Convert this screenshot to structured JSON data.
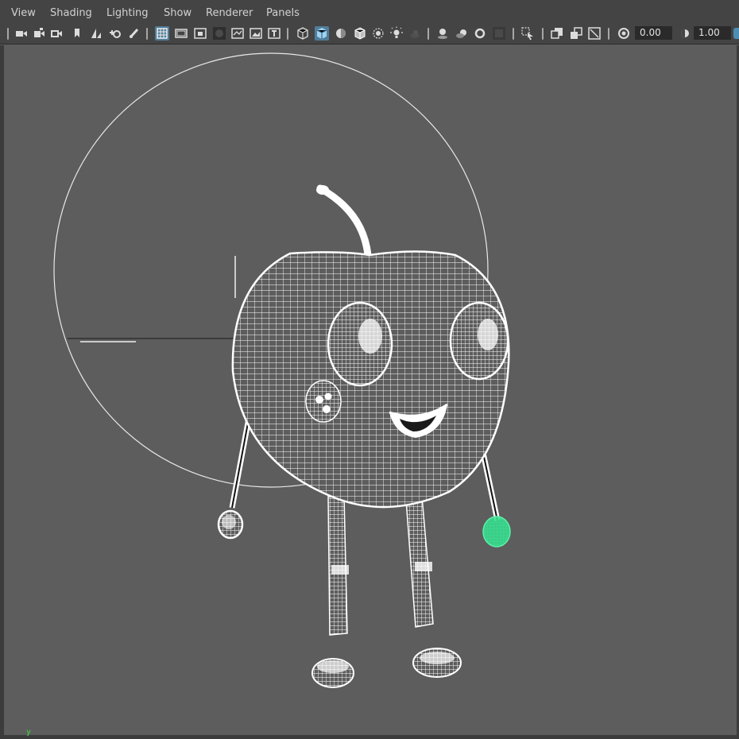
{
  "menu": {
    "items": [
      "View",
      "Shading",
      "Lighting",
      "Show",
      "Renderer",
      "Panels"
    ]
  },
  "toolbar": {
    "exposure_value": "0.00",
    "gamma_value": "1.00",
    "icons": [
      "camera-icon",
      "camera-attributes-icon",
      "camera-select-icon",
      "bookmark-icon",
      "image-plane-icon",
      "two-d-pan-zoom-icon",
      "grease-pencil-icon",
      "grid-icon",
      "film-gate-icon",
      "resolution-gate-icon",
      "gate-mask-icon",
      "field-chart-icon",
      "safe-action-icon",
      "safe-title-icon",
      "wireframe-icon",
      "smooth-shade-icon",
      "default-material-icon",
      "wireframe-on-shaded-icon",
      "xray-icon",
      "use-all-lights-icon",
      "shadows-icon",
      "ambient-occlusion-icon",
      "motion-blur-icon",
      "antialiasing-icon",
      "depth-of-field-icon",
      "isolate-select-icon",
      "xray-joints-icon",
      "xray-active-icon",
      "backface-culling-icon",
      "exposure-icon",
      "gamma-icon"
    ],
    "colors": {
      "bar": "#444444",
      "active": "#517d9a",
      "icon": "#dcdcdc"
    }
  },
  "viewport": {
    "background": "#5d5d5d",
    "wireframe_color": "#ffffff",
    "selected_color": "#36e08f",
    "axis_label": "y"
  }
}
